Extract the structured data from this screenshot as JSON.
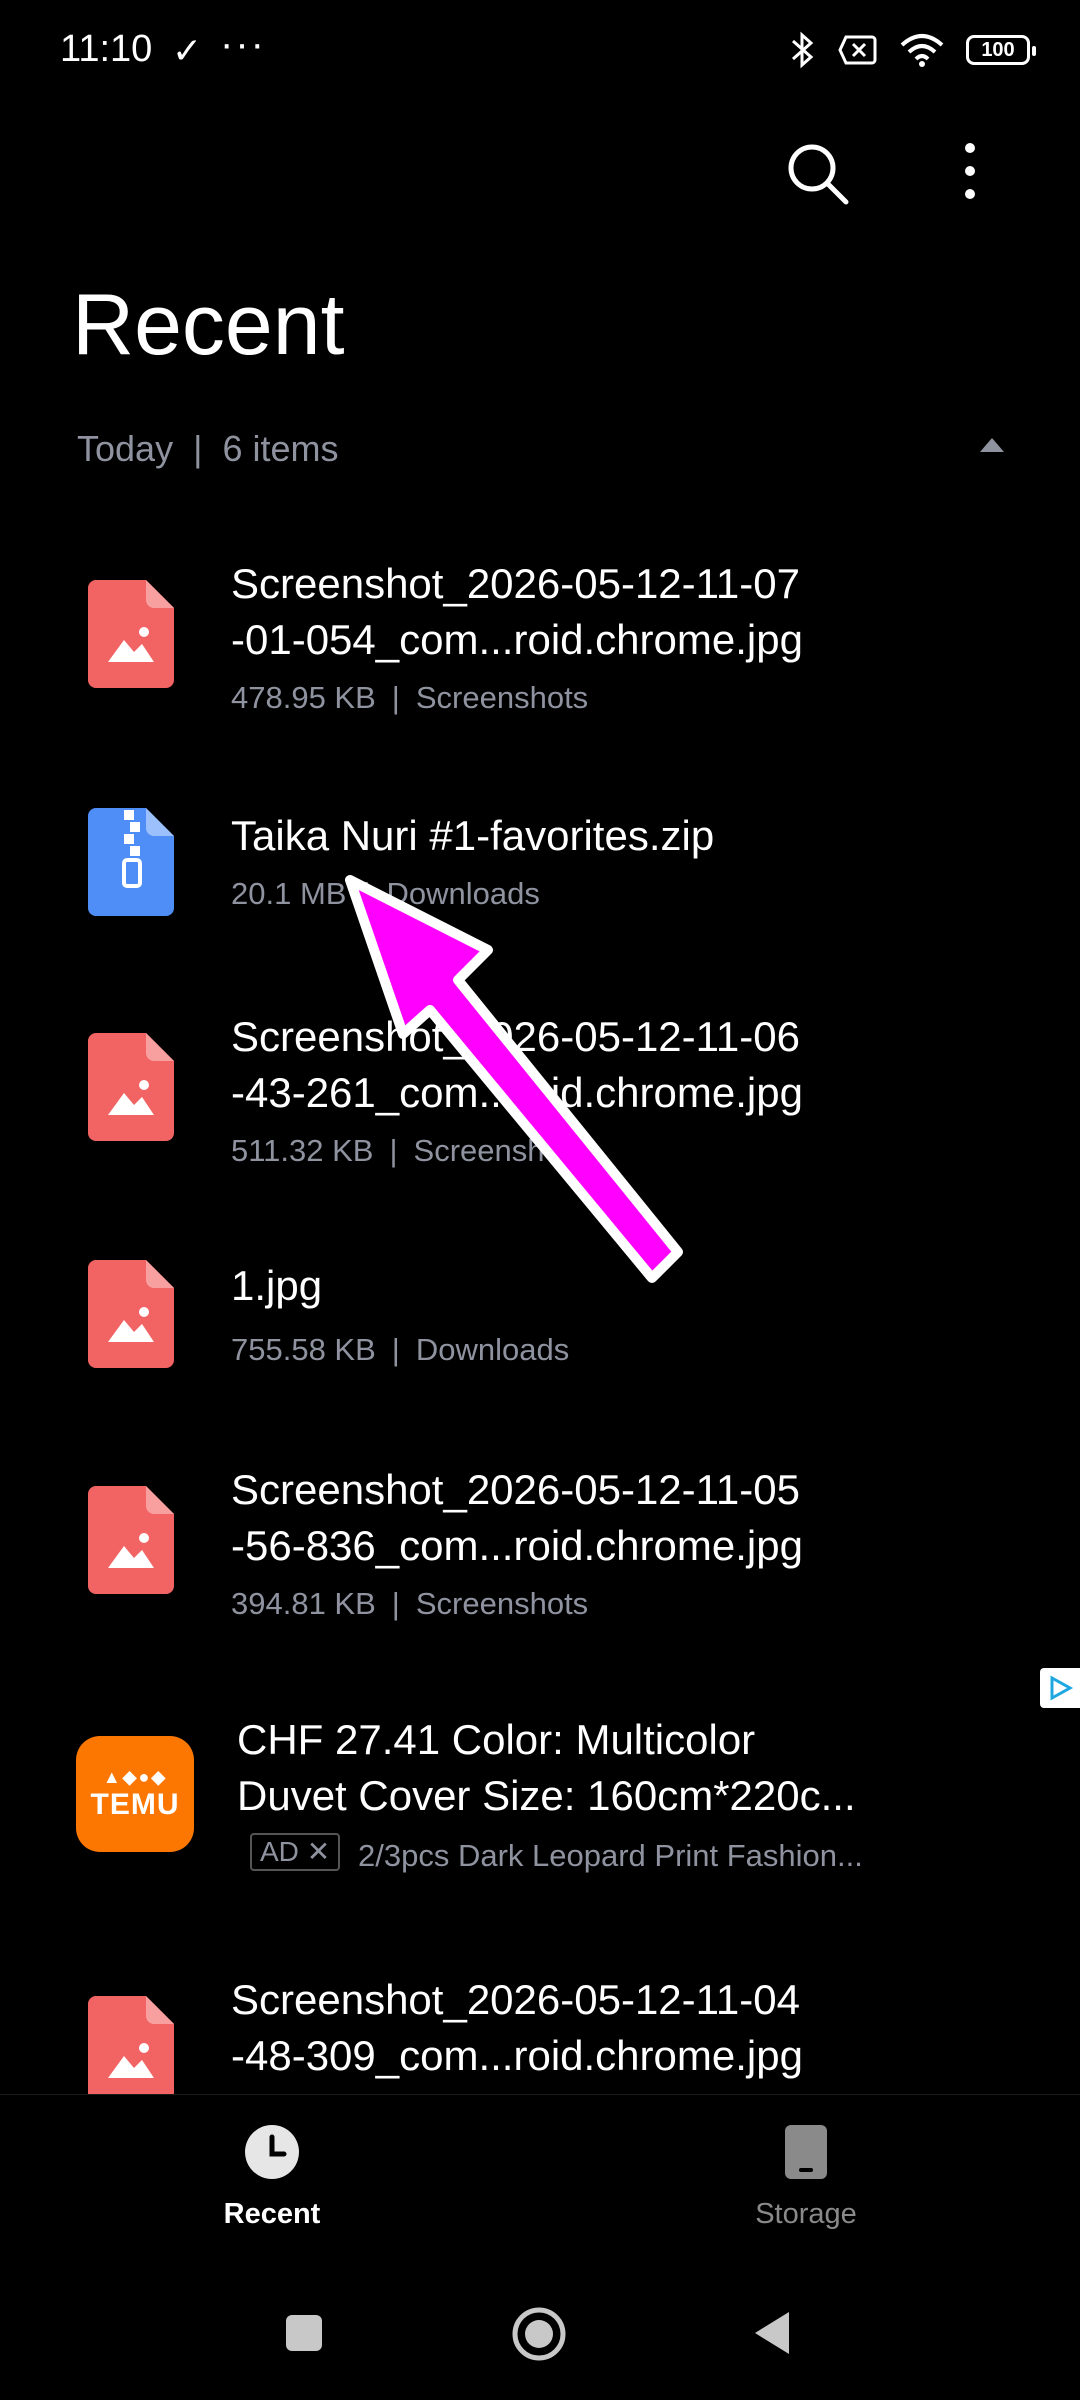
{
  "status_bar": {
    "time": "11:10",
    "battery": "100"
  },
  "header": {
    "title": "Recent"
  },
  "section": {
    "label": "Today",
    "count": "6 items"
  },
  "files": [
    {
      "name_line1": "Screenshot_2026-05-12-11-07",
      "name_line2": "-01-054_com...roid.chrome.jpg",
      "size": "478.95 KB",
      "folder": "Screenshots",
      "type": "image"
    },
    {
      "name_line1": "Taika Nuri #1-favorites.zip",
      "name_line2": "",
      "size": "20.1 MB",
      "folder": "Downloads",
      "type": "zip"
    },
    {
      "name_line1": "Screenshot_2026-05-12-11-06",
      "name_line2": "-43-261_com...roid.chrome.jpg",
      "size": "511.32 KB",
      "folder": "Screenshots",
      "type": "image"
    },
    {
      "name_line1": "1.jpg",
      "name_line2": "",
      "size": "755.58 KB",
      "folder": "Downloads",
      "type": "image"
    },
    {
      "name_line1": "Screenshot_2026-05-12-11-05",
      "name_line2": "-56-836_com...roid.chrome.jpg",
      "size": "394.81 KB",
      "folder": "Screenshots",
      "type": "image"
    },
    {
      "name_line1": "Screenshot_2026-05-12-11-04",
      "name_line2": "-48-309_com...roid.chrome.jpg",
      "size": "",
      "folder": "",
      "type": "image"
    }
  ],
  "ad": {
    "brand": "TEMU",
    "title_line1": "CHF 27.41 Color: Multicolor",
    "title_line2": "Duvet Cover Size: 160cm*220c...",
    "badge": "AD",
    "description": "2/3pcs Dark Leopard Print Fashion..."
  },
  "bottom_nav": {
    "recent": "Recent",
    "storage": "Storage"
  },
  "colors": {
    "image_icon": "#f26363",
    "zip_icon": "#4f8ef7",
    "temu": "#fb7701",
    "annotation_arrow": "#ff00ff"
  }
}
